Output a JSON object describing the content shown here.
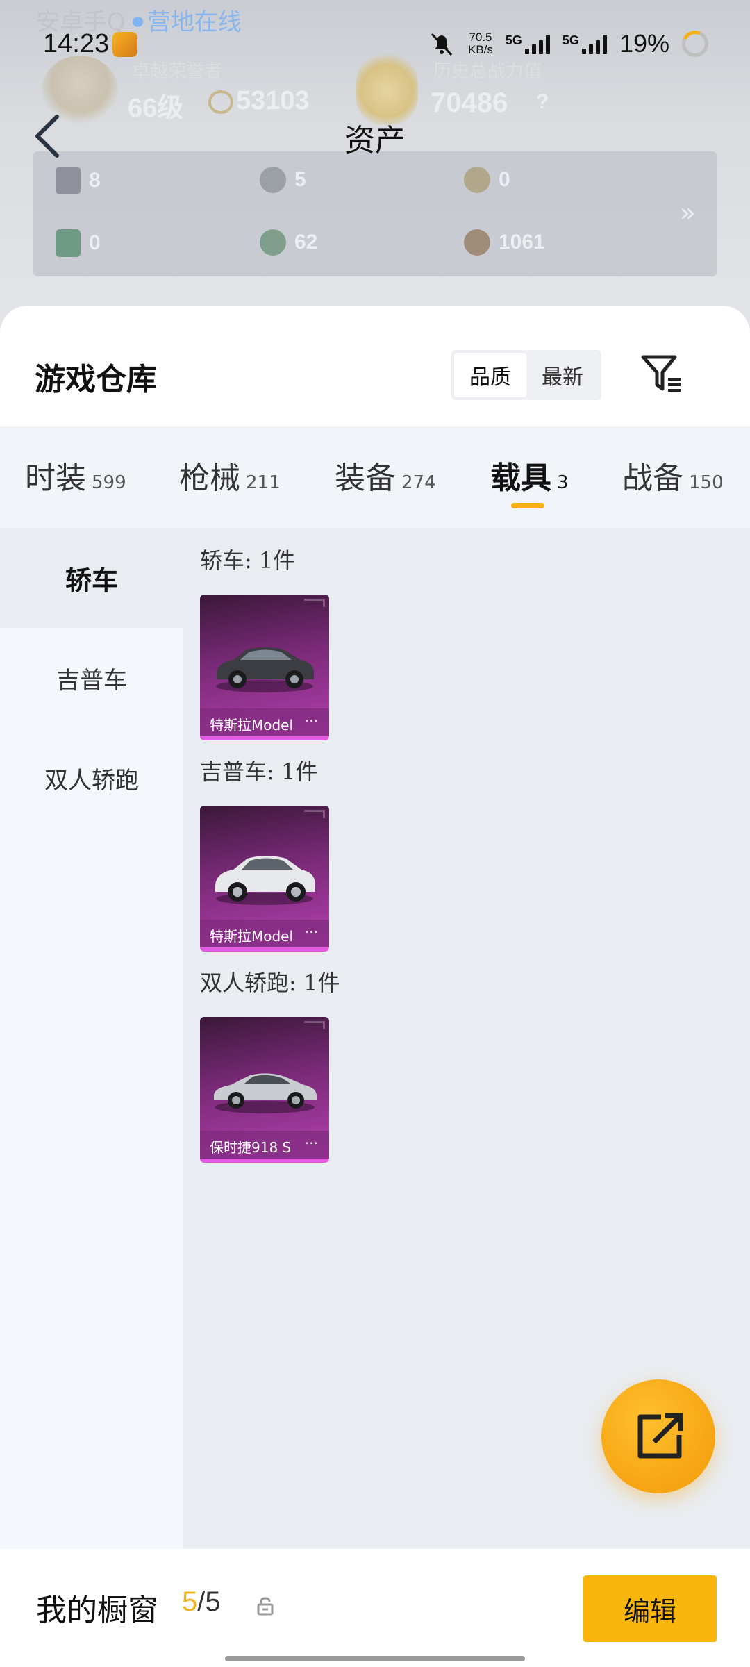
{
  "status_bar": {
    "time": "14:23",
    "net_speed_value": "70.5",
    "net_speed_unit": "KB/s",
    "sim1": "5G",
    "sim2": "5G",
    "battery": "19%"
  },
  "background": {
    "game_tag": "安卓手Q",
    "online_status": "营地在线",
    "label_left": "卓越荣誉者",
    "level": "66级",
    "rank_points": "53103",
    "label_right": "历史总战力值",
    "power_value": "70486",
    "help": "?"
  },
  "header": {
    "title": "资产"
  },
  "assets": [
    {
      "icon": "card-icon",
      "value": "8",
      "color": "#8e9199"
    },
    {
      "icon": "coin-icon",
      "value": "5",
      "color": "#9b9fa6"
    },
    {
      "icon": "medal-icon",
      "value": "0",
      "color": "#b1a88c"
    },
    {
      "icon": "ticket-icon",
      "value": "0",
      "color": "#6f9a86"
    },
    {
      "icon": "gem-icon",
      "value": "62",
      "color": "#7f9e8c"
    },
    {
      "icon": "bronze-icon",
      "value": "1061",
      "color": "#a08a78"
    }
  ],
  "warehouse": {
    "title": "游戏仓库",
    "sort_options": [
      "品质",
      "最新"
    ],
    "active_sort": "品质"
  },
  "tabs": [
    {
      "label": "时装",
      "count": "599"
    },
    {
      "label": "枪械",
      "count": "211"
    },
    {
      "label": "装备",
      "count": "274"
    },
    {
      "label": "载具",
      "count": "3"
    },
    {
      "label": "战备",
      "count": "150"
    }
  ],
  "active_tab": "载具",
  "sidebar": [
    "轿车",
    "吉普车",
    "双人轿跑"
  ],
  "groups": [
    {
      "title": "轿车: 1件",
      "item_name": "特斯拉Model",
      "car_color": "dark"
    },
    {
      "title": "吉普车: 1件",
      "item_name": "特斯拉Model",
      "car_color": "white"
    },
    {
      "title": "双人轿跑: 1件",
      "item_name": "保时捷918 S",
      "car_color": "silver"
    }
  ],
  "bottom": {
    "title": "我的橱窗",
    "current": "5",
    "total": "/5",
    "edit_label": "编辑"
  }
}
